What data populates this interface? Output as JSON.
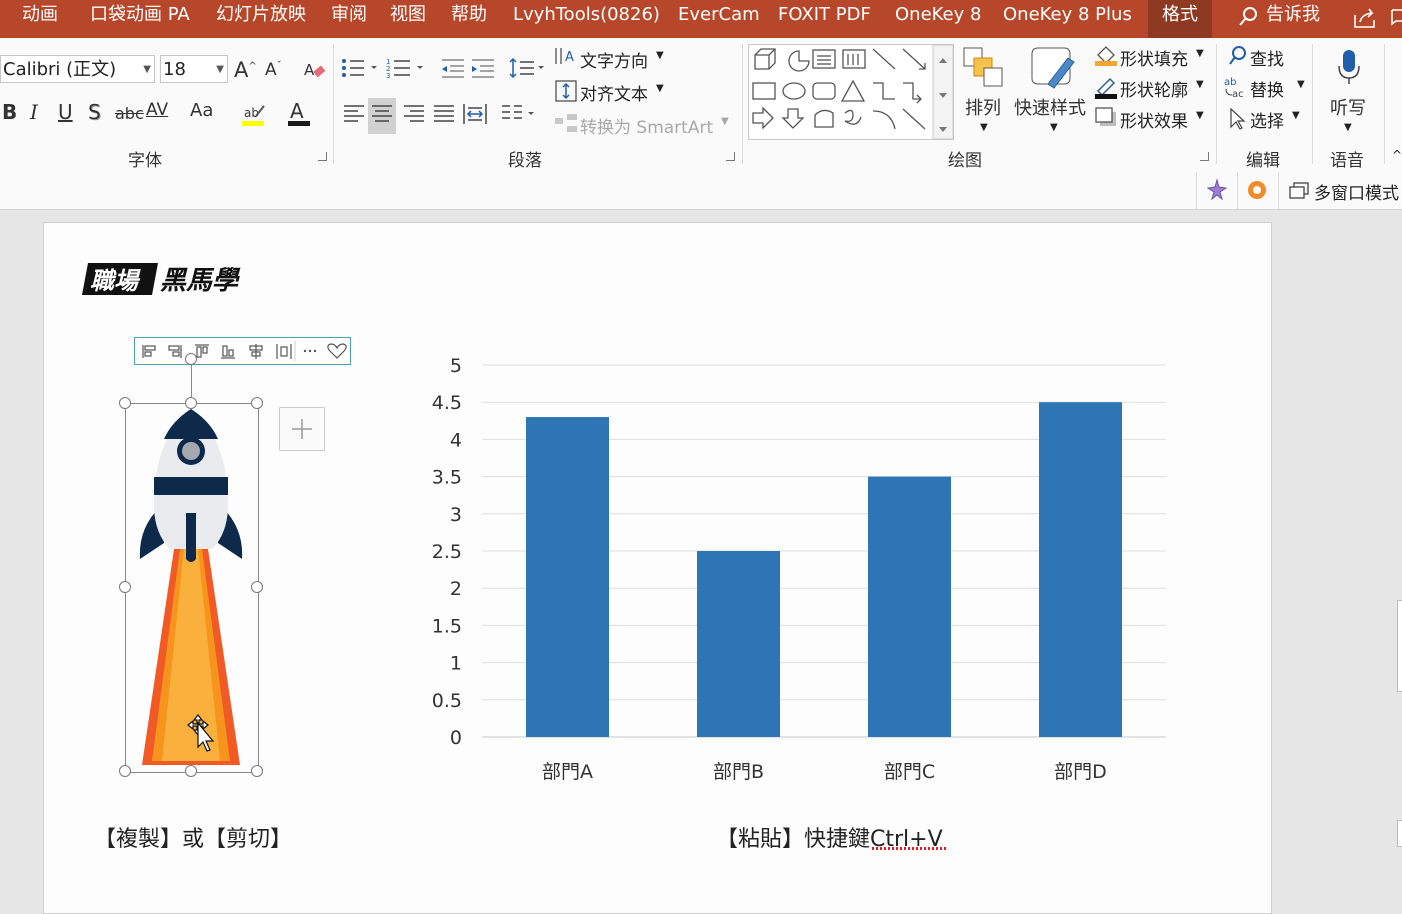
{
  "menubar": {
    "tabs": [
      "动画",
      "口袋动画 PA",
      "幻灯片放映",
      "审阅",
      "视图",
      "帮助",
      "LvyhTools(0826)",
      "EverCam",
      "FOXIT PDF",
      "OneKey 8",
      "OneKey 8 Plus",
      "格式"
    ],
    "active_tab": "格式",
    "tell_me": "告诉我"
  },
  "ribbon": {
    "font": {
      "name": "Calibri (正文)",
      "size": "18",
      "group_label": "字体",
      "bold": "B",
      "italic": "I",
      "underline": "U",
      "shadow": "S",
      "strike": "abc",
      "spacing": "AV",
      "case": "Aa"
    },
    "paragraph": {
      "text_direction": "文字方向",
      "align_text": "对齐文本",
      "smartart": "转换为 SmartArt",
      "group_label": "段落"
    },
    "drawing": {
      "arrange": "排列",
      "quick_styles": "快速样式",
      "shape_fill": "形状填充",
      "shape_outline": "形状轮廓",
      "shape_effects": "形状效果",
      "group_label": "绘图"
    },
    "editing": {
      "find": "查找",
      "replace": "替换",
      "select": "选择",
      "group_label": "编辑"
    },
    "voice": {
      "dictate": "听写",
      "group_label": "语音"
    }
  },
  "qbar": {
    "multiwindow": "多窗口模式"
  },
  "slide": {
    "logo_text": "職場黑馬學",
    "caption_left": "【複製】或【剪切】",
    "caption_right": "【粘貼】快捷鍵Ctrl+V"
  },
  "colors": {
    "menubar": "#b7472a",
    "bar": "#2e75b6",
    "rocket_navy": "#0d2a4a",
    "flame_outer": "#f15a24",
    "flame_inner": "#f9b03c"
  },
  "chart_data": {
    "type": "bar",
    "categories": [
      "部門A",
      "部門B",
      "部門C",
      "部門D"
    ],
    "values": [
      4.3,
      2.5,
      3.5,
      4.5
    ],
    "ylim": [
      0,
      5
    ],
    "yticks": [
      "0",
      "0.5",
      "1",
      "1.5",
      "2",
      "2.5",
      "3",
      "3.5",
      "4",
      "4.5",
      "5"
    ],
    "grid": true,
    "legend": "none"
  }
}
